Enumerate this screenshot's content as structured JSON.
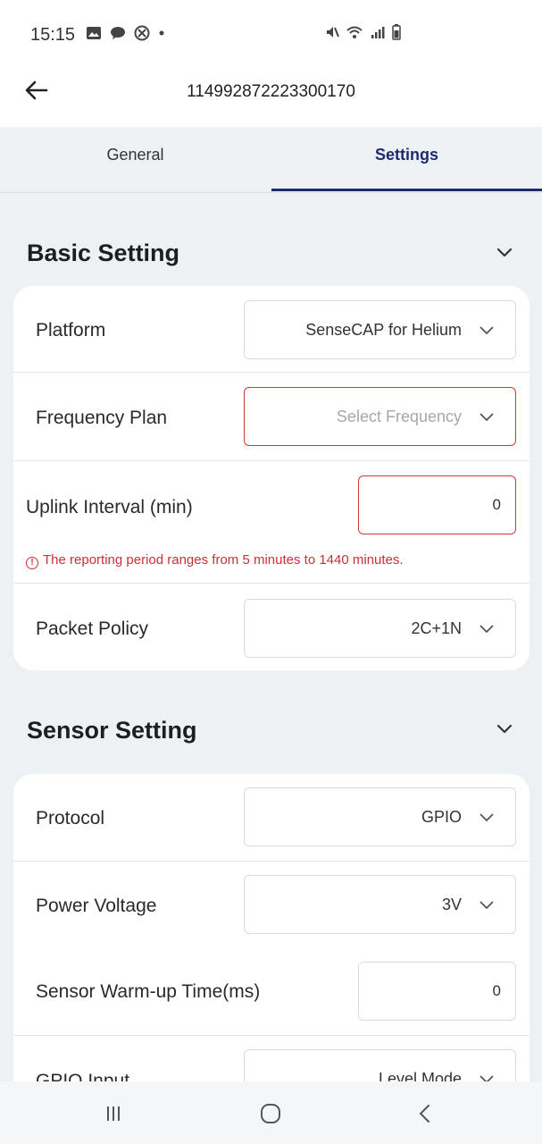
{
  "status_bar": {
    "time": "15:15",
    "left_icons": [
      "image-icon",
      "chat-icon",
      "blocked-icon",
      "dot-icon"
    ],
    "right_icons": [
      "mute-icon",
      "wifi-icon",
      "signal-icon",
      "battery-icon"
    ]
  },
  "app_bar": {
    "title": "114992872223300170"
  },
  "tabs": [
    {
      "label": "General",
      "active": false
    },
    {
      "label": "Settings",
      "active": true
    }
  ],
  "basic_setting": {
    "title": "Basic Setting",
    "platform": {
      "label": "Platform",
      "value": "SenseCAP for Helium"
    },
    "frequency_plan": {
      "label": "Frequency Plan",
      "placeholder": "Select Frequency"
    },
    "uplink_interval": {
      "label": "Uplink Interval (min)",
      "value": "0",
      "error": "The reporting period ranges from 5 minutes to 1440 minutes."
    },
    "packet_policy": {
      "label": "Packet Policy",
      "value": "2C+1N"
    }
  },
  "sensor_setting": {
    "title": "Sensor Setting",
    "protocol": {
      "label": "Protocol",
      "value": "GPIO"
    },
    "power_voltage": {
      "label": "Power Voltage",
      "value": "3V"
    },
    "warmup_time": {
      "label": "Sensor Warm-up Time(ms)",
      "value": "0"
    },
    "gpio_input": {
      "label": "GPIO Input",
      "value": "Level Mode"
    }
  },
  "colors": {
    "accent": "#1d2b6e",
    "error": "#c7313a",
    "background": "#eef1f4",
    "card": "#ffffff"
  },
  "nav_bar": {
    "buttons": [
      "recent-apps-icon",
      "home-icon",
      "back-icon"
    ]
  }
}
